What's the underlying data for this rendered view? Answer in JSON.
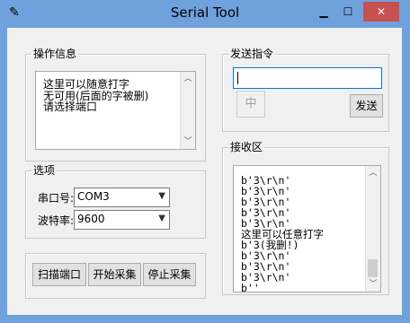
{
  "window": {
    "title": "Serial Tool",
    "icon": "feather-icon",
    "controls": {
      "minimize": "▁",
      "maximize": "☐",
      "close": "✕"
    }
  },
  "info_group": {
    "legend": "操作信息",
    "text": "这里可以随意打字\n无可用(后面的字被删)\n请选择端口"
  },
  "options_group": {
    "legend": "选项",
    "port_label": "串口号:",
    "port_value": "COM3",
    "baud_label": "波特率:",
    "baud_value": "9600"
  },
  "action_buttons": {
    "scan": "扫描端口",
    "start": "开始采集",
    "stop": "停止采集"
  },
  "send_group": {
    "legend": "发送指令",
    "input_value": "",
    "zh_button": "中",
    "send_button": "发送"
  },
  "receive_group": {
    "legend": "接收区",
    "lines": "b'3\\r\\n'\nb'3\\r\\n'\nb'3\\r\\n'\nb'3\\r\\n'\nb'3\\r\\n'\n这里可以任意打字\nb'3(我删!)\nb'3\\r\\n'\nb'3\\r\\n'\nb'3\\r\\n'\nb''"
  },
  "colors": {
    "titlebar": "#6fa2dc",
    "close": "#c75050",
    "panel": "#f0f0f0",
    "focus_border": "#0078d7"
  }
}
